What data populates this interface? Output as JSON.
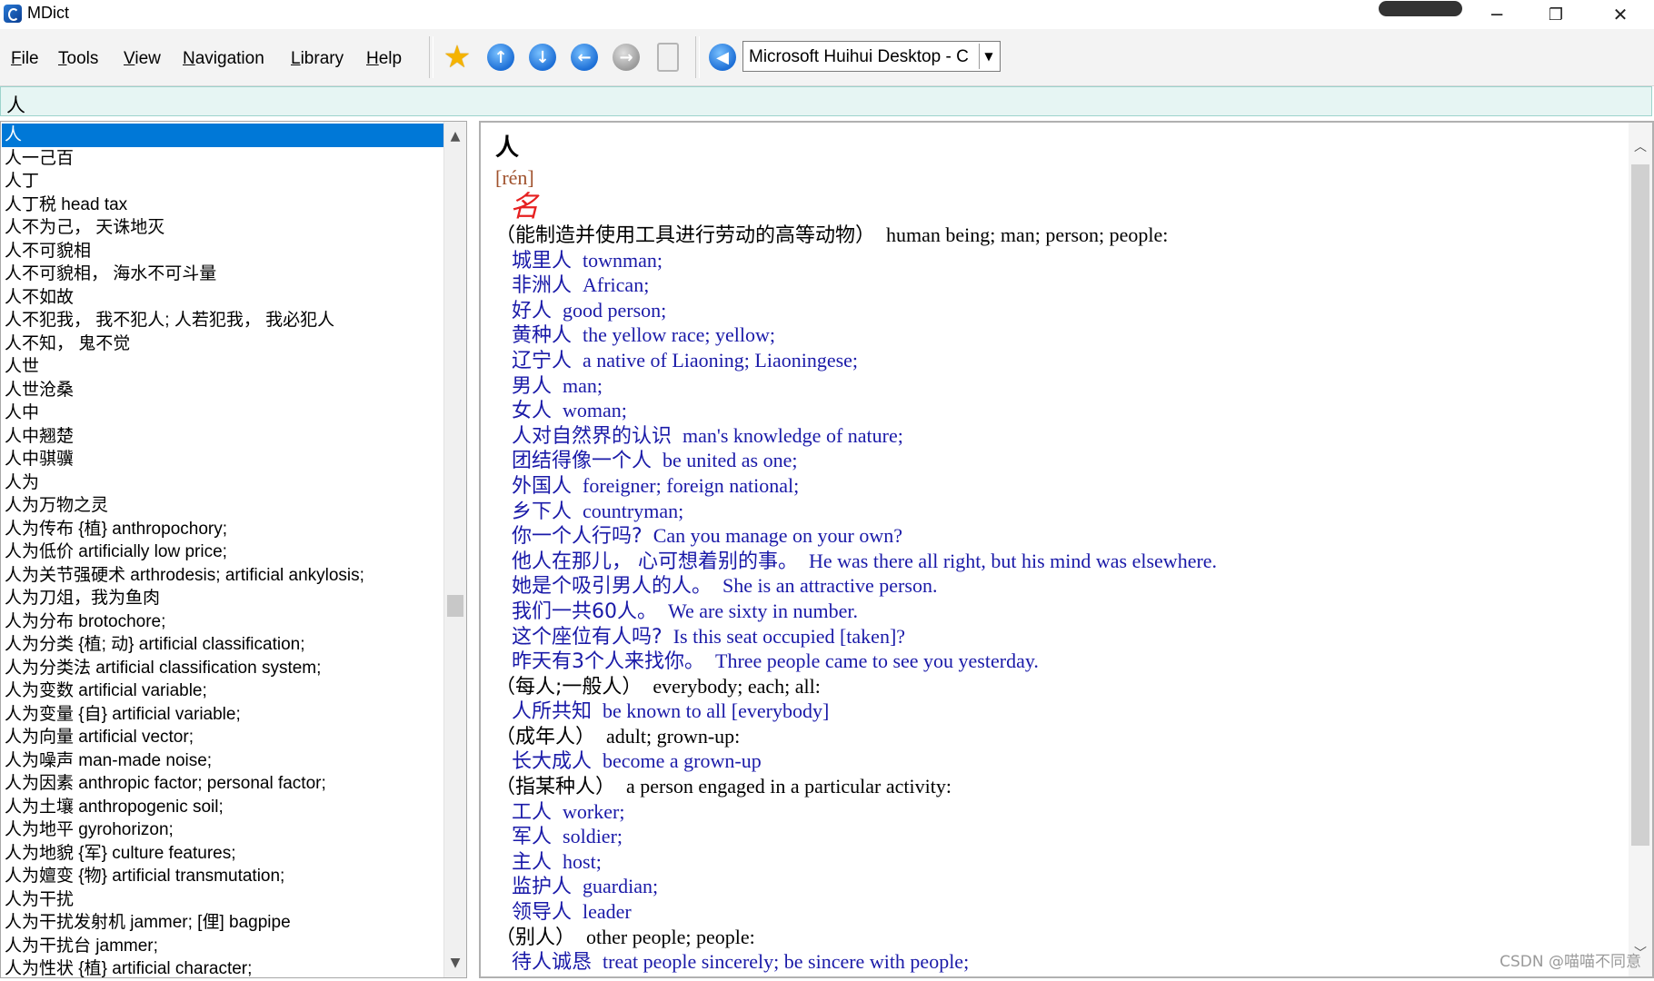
{
  "window": {
    "title": "MDict",
    "minimize": "─",
    "maximize": "❐",
    "close": "✕"
  },
  "menu": [
    "File",
    "Tools",
    "View",
    "Navigation",
    "Library",
    "Help"
  ],
  "toolbar": {
    "icons": [
      "favorite-star-icon",
      "up-arrow-icon",
      "down-arrow-icon",
      "back-arrow-icon",
      "forward-arrow-icon",
      "clipboard-icon",
      "speaker-icon"
    ],
    "dictionary_selected": "Microsoft Huihui Desktop - C"
  },
  "search": {
    "value": "人"
  },
  "wordlist": {
    "selected_index": 0,
    "items": [
      "人",
      "人一己百",
      "人丁",
      "人丁税 head tax",
      "人不为己， 天诛地灭",
      "人不可貌相",
      "人不可貌相， 海水不可斗量",
      "人不如故",
      "人不犯我， 我不犯人; 人若犯我， 我必犯人",
      "人不知， 鬼不觉",
      "人世",
      "人世沧桑",
      "人中",
      "人中翘楚",
      "人中骐骥",
      "人为",
      "人为万物之灵",
      "人为传布 {植} anthropochory;",
      "人为低价 artificially low price;",
      "人为关节强硬术 arthrodesis; artificial ankylosis;",
      "人为刀俎，我为鱼肉",
      "人为分布 brotochore;",
      "人为分类 {植; 动} artificial classification;",
      "人为分类法 artificial classification system;",
      "人为变数 artificial variable;",
      "人为变量 {自} artificial variable;",
      "人为向量 artificial vector;",
      "人为噪声 man-made noise;",
      "人为因素 anthropic factor; personal factor;",
      "人为土壤 anthropogenic soil;",
      "人为地平 gyrohorizon;",
      "人为地貌 {军} culture features;",
      "人为嬗变 {物} artificial transmutation;",
      "人为干扰",
      "人为干扰发射机 jammer; [俚] bagpipe",
      "人为干扰台 jammer;",
      "人为性状 {植} artificial character;"
    ]
  },
  "entry": {
    "headword": "人",
    "pinyin": "[rén]",
    "pos": "名",
    "lines": [
      {
        "type": "def",
        "zh": "（能制造并使用工具进行劳动的高等动物）",
        "en": "human being; man; person; people:"
      },
      {
        "type": "ex",
        "zh": "城里人",
        "en": "townman;"
      },
      {
        "type": "ex",
        "zh": "非洲人",
        "en": "African;"
      },
      {
        "type": "ex",
        "zh": "好人",
        "en": "good person;"
      },
      {
        "type": "ex",
        "zh": "黄种人",
        "en": "the yellow race; yellow;"
      },
      {
        "type": "ex",
        "zh": "辽宁人",
        "en": "a native of Liaoning; Liaoningese;"
      },
      {
        "type": "ex",
        "zh": "男人",
        "en": "man;"
      },
      {
        "type": "ex",
        "zh": "女人",
        "en": "woman;"
      },
      {
        "type": "ex",
        "zh": "人对自然界的认识",
        "en": "man's knowledge of nature;"
      },
      {
        "type": "ex",
        "zh": "团结得像一个人",
        "en": "be united as one;"
      },
      {
        "type": "ex",
        "zh": "外国人",
        "en": "foreigner; foreign national;"
      },
      {
        "type": "ex",
        "zh": "乡下人",
        "en": "countryman;"
      },
      {
        "type": "ex",
        "zh": "你一个人行吗?",
        "en": "Can you manage on your own?"
      },
      {
        "type": "ex",
        "zh": "他人在那儿， 心可想着别的事。",
        "en": "He was there all right, but his mind was elsewhere."
      },
      {
        "type": "ex",
        "zh": "她是个吸引男人的人。",
        "en": "She is an attractive person."
      },
      {
        "type": "ex",
        "zh": "我们一共60人。",
        "en": "We are sixty in number."
      },
      {
        "type": "ex",
        "zh": "这个座位有人吗?",
        "en": "Is this seat occupied [taken]?"
      },
      {
        "type": "ex",
        "zh": "昨天有3个人来找你。",
        "en": "Three people came to see you yesterday."
      },
      {
        "type": "def",
        "zh": "（每人;一般人）",
        "en": "everybody; each; all:"
      },
      {
        "type": "ex",
        "zh": "人所共知",
        "en": "be known to all [everybody]"
      },
      {
        "type": "def",
        "zh": "（成年人）",
        "en": "adult; grown-up:"
      },
      {
        "type": "ex",
        "zh": "长大成人",
        "en": "become a grown-up"
      },
      {
        "type": "def",
        "zh": "（指某种人）",
        "en": "a person engaged in a particular activity:"
      },
      {
        "type": "ex",
        "zh": "工人",
        "en": "worker;"
      },
      {
        "type": "ex",
        "zh": "军人",
        "en": "soldier;"
      },
      {
        "type": "ex",
        "zh": "主人",
        "en": "host;"
      },
      {
        "type": "ex",
        "zh": "监护人",
        "en": "guardian;"
      },
      {
        "type": "ex",
        "zh": "领导人",
        "en": "leader"
      },
      {
        "type": "def",
        "zh": "（别人）",
        "en": "other people; people:"
      },
      {
        "type": "ex",
        "zh": "待人诚恳",
        "en": "treat people sincerely; be sincere with people;"
      }
    ]
  },
  "watermark": "CSDN @喵喵不同意",
  "colors": {
    "selection": "#0078d7",
    "example_text": "#1a1aa8",
    "pinyin": "#a0522d",
    "pos": "#e62020",
    "search_bg": "#e6f5f3"
  }
}
